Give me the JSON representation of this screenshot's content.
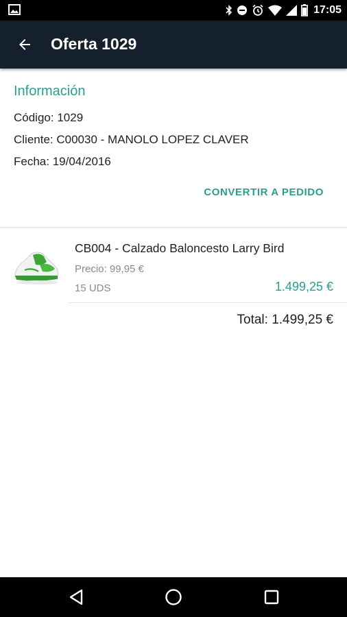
{
  "status_bar": {
    "time": "17:05",
    "icons": [
      "image-icon",
      "bluetooth-icon",
      "do-not-disturb-icon",
      "alarm-icon",
      "wifi-icon",
      "signal-icon",
      "battery-icon"
    ]
  },
  "app_bar": {
    "title": "Oferta 1029",
    "back_icon": "arrow-back-icon"
  },
  "info": {
    "heading": "Información",
    "codigo_label": "Código:",
    "codigo_value": "1029",
    "cliente_label": "Cliente:",
    "cliente_value": "C00030 - MANOLO LOPEZ CLAVER",
    "fecha_label": "Fecha:",
    "fecha_value": "19/04/2016",
    "convert_button": "CONVERTIR A PEDIDO"
  },
  "lines": [
    {
      "title": "CB004 - Calzado Baloncesto Larry Bird",
      "price": "Precio: 99,95 €",
      "quantity": "15 UDS",
      "amount": "1.499,25 €",
      "image": "basketball-shoe"
    }
  ],
  "total": "Total: 1.499,25 €",
  "nav_bar": {
    "icons": [
      "nav-back-icon",
      "nav-home-icon",
      "nav-recent-icon"
    ]
  },
  "colors": {
    "app_bar": "#14212d",
    "accent": "#2a9d8f",
    "status_bar": "#000000",
    "nav_bar": "#000000"
  }
}
